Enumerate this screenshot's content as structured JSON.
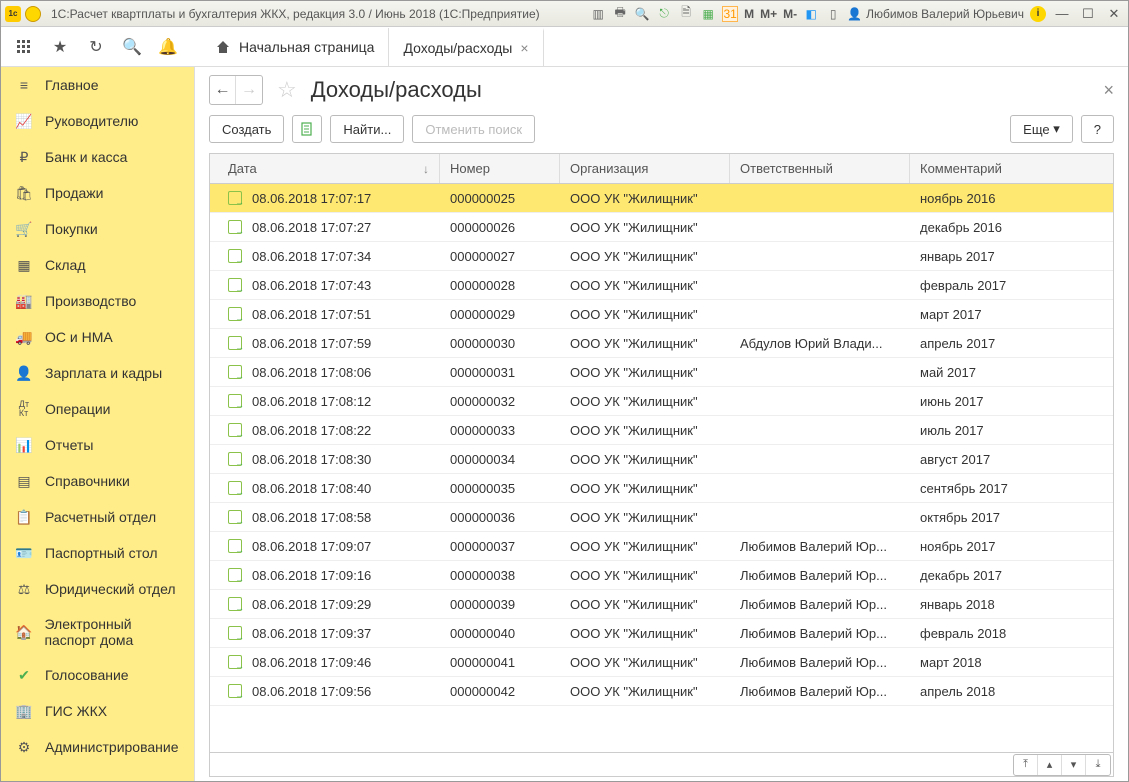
{
  "titlebar": {
    "title": "1С:Расчет квартплаты и бухгалтерия ЖКХ, редакция 3.0 / Июнь 2018  (1С:Предприятие)",
    "user": "Любимов Валерий Юрьевич",
    "m1": "M",
    "m2": "M+",
    "m3": "M-"
  },
  "tabs": {
    "home": "Начальная страница",
    "active": "Доходы/расходы"
  },
  "sidebar": {
    "items": [
      "Главное",
      "Руководителю",
      "Банк и касса",
      "Продажи",
      "Покупки",
      "Склад",
      "Производство",
      "ОС и НМА",
      "Зарплата и кадры",
      "Операции",
      "Отчеты",
      "Справочники",
      "Расчетный отдел",
      "Паспортный стол",
      "Юридический отдел",
      "Электронный паспорт дома",
      "Голосование",
      "ГИС ЖКХ",
      "Администрирование"
    ]
  },
  "page": {
    "title": "Доходы/расходы"
  },
  "actions": {
    "create": "Создать",
    "find": "Найти...",
    "cancel_search": "Отменить поиск",
    "more": "Еще",
    "help": "?"
  },
  "columns": {
    "date": "Дата",
    "number": "Номер",
    "org": "Организация",
    "resp": "Ответственный",
    "comment": "Комментарий"
  },
  "rows": [
    {
      "date": "08.06.2018 17:07:17",
      "number": "000000025",
      "org": "ООО УК \"Жилищник\"",
      "resp": "",
      "comment": "ноябрь 2016"
    },
    {
      "date": "08.06.2018 17:07:27",
      "number": "000000026",
      "org": "ООО УК \"Жилищник\"",
      "resp": "",
      "comment": "декабрь 2016"
    },
    {
      "date": "08.06.2018 17:07:34",
      "number": "000000027",
      "org": "ООО УК \"Жилищник\"",
      "resp": "",
      "comment": "январь 2017"
    },
    {
      "date": "08.06.2018 17:07:43",
      "number": "000000028",
      "org": "ООО УК \"Жилищник\"",
      "resp": "",
      "comment": "февраль 2017"
    },
    {
      "date": "08.06.2018 17:07:51",
      "number": "000000029",
      "org": "ООО УК \"Жилищник\"",
      "resp": "",
      "comment": "март 2017"
    },
    {
      "date": "08.06.2018 17:07:59",
      "number": "000000030",
      "org": "ООО УК \"Жилищник\"",
      "resp": "Абдулов Юрий Влади...",
      "comment": "апрель 2017"
    },
    {
      "date": "08.06.2018 17:08:06",
      "number": "000000031",
      "org": "ООО УК \"Жилищник\"",
      "resp": "",
      "comment": "май 2017"
    },
    {
      "date": "08.06.2018 17:08:12",
      "number": "000000032",
      "org": "ООО УК \"Жилищник\"",
      "resp": "",
      "comment": "июнь 2017"
    },
    {
      "date": "08.06.2018 17:08:22",
      "number": "000000033",
      "org": "ООО УК \"Жилищник\"",
      "resp": "",
      "comment": "июль 2017"
    },
    {
      "date": "08.06.2018 17:08:30",
      "number": "000000034",
      "org": "ООО УК \"Жилищник\"",
      "resp": "",
      "comment": "август 2017"
    },
    {
      "date": "08.06.2018 17:08:40",
      "number": "000000035",
      "org": "ООО УК \"Жилищник\"",
      "resp": "",
      "comment": "сентябрь 2017"
    },
    {
      "date": "08.06.2018 17:08:58",
      "number": "000000036",
      "org": "ООО УК \"Жилищник\"",
      "resp": "",
      "comment": "октябрь 2017"
    },
    {
      "date": "08.06.2018 17:09:07",
      "number": "000000037",
      "org": "ООО УК \"Жилищник\"",
      "resp": "Любимов Валерий Юр...",
      "comment": "ноябрь 2017"
    },
    {
      "date": "08.06.2018 17:09:16",
      "number": "000000038",
      "org": "ООО УК \"Жилищник\"",
      "resp": "Любимов Валерий Юр...",
      "comment": "декабрь 2017"
    },
    {
      "date": "08.06.2018 17:09:29",
      "number": "000000039",
      "org": "ООО УК \"Жилищник\"",
      "resp": "Любимов Валерий Юр...",
      "comment": "январь 2018"
    },
    {
      "date": "08.06.2018 17:09:37",
      "number": "000000040",
      "org": "ООО УК \"Жилищник\"",
      "resp": "Любимов Валерий Юр...",
      "comment": "февраль 2018"
    },
    {
      "date": "08.06.2018 17:09:46",
      "number": "000000041",
      "org": "ООО УК \"Жилищник\"",
      "resp": "Любимов Валерий Юр...",
      "comment": "март 2018"
    },
    {
      "date": "08.06.2018 17:09:56",
      "number": "000000042",
      "org": "ООО УК \"Жилищник\"",
      "resp": "Любимов Валерий Юр...",
      "comment": "апрель 2018"
    }
  ]
}
